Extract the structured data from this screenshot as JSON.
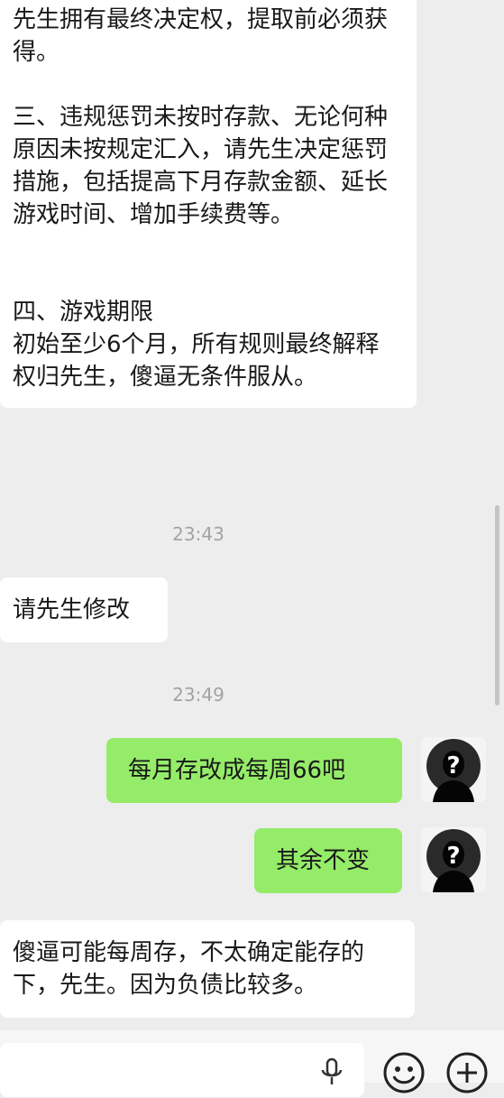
{
  "messages": [
    {
      "direction": "incoming",
      "lines": [
        "先生拥有最终决定权，提取前必须获得。",
        "",
        "三、违规惩罚未按时存款、无论何种原因未按规定汇入，请先生决定惩罚措施，包括提高下月存款金额、延长游戏时间、增加手续费等。",
        "",
        "",
        "四、游戏期限",
        "初始至少6个月，所有规则最终解释权归先生，傻逼无条件服从。"
      ]
    },
    {
      "timestamp": "23:43"
    },
    {
      "direction": "incoming",
      "text": "请先生修改"
    },
    {
      "timestamp": "23:49"
    },
    {
      "direction": "outgoing",
      "text": "每月存改成每周66吧"
    },
    {
      "direction": "outgoing",
      "text": "其余不变"
    },
    {
      "direction": "incoming",
      "text": "傻逼可能每周存，不太确定能存的下，先生。因为负债比较多。"
    }
  ],
  "composer": {
    "input_value": "",
    "icons": [
      "voice-icon",
      "emoji-icon",
      "plus-icon"
    ]
  },
  "colors": {
    "background": "#ededed",
    "incoming_bubble": "#ffffff",
    "outgoing_bubble": "#95ec69",
    "timestamp": "#a3a3a3"
  }
}
